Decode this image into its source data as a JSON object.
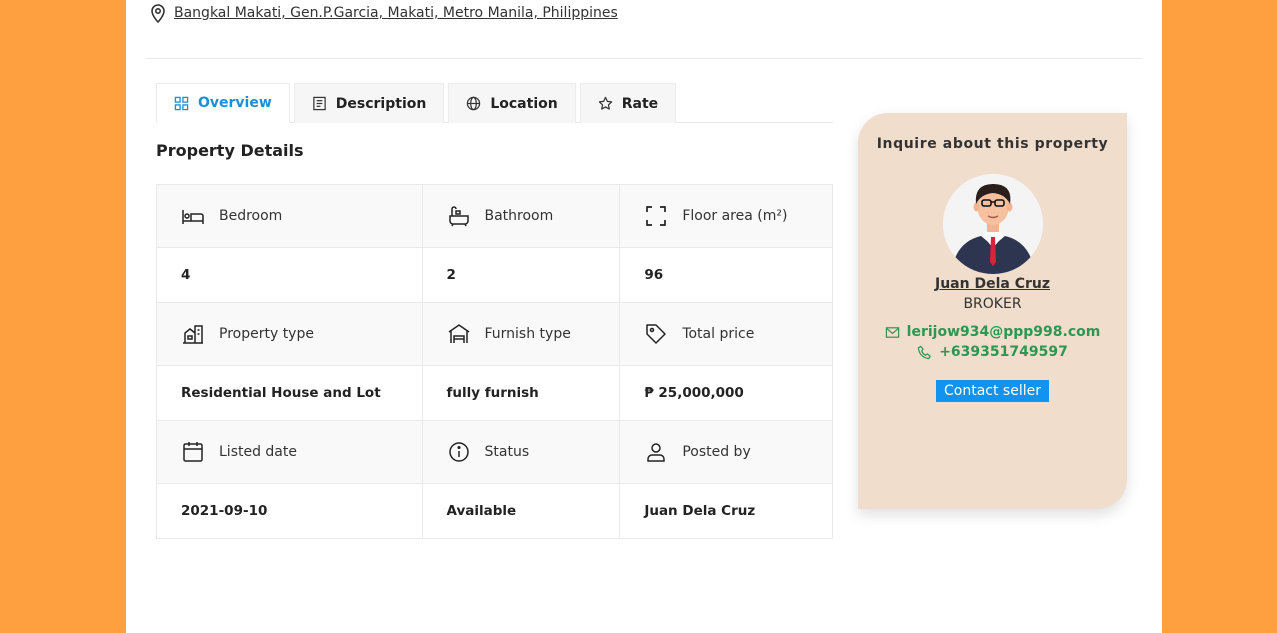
{
  "address": {
    "text": "Bangkal Makati, Gen.P.Garcia, Makati, Metro Manila, Philippines"
  },
  "tabs": [
    {
      "label": "Overview",
      "icon": "grid-icon"
    },
    {
      "label": "Description",
      "icon": "document-icon"
    },
    {
      "label": "Location",
      "icon": "globe-icon"
    },
    {
      "label": "Rate",
      "icon": "star-icon"
    }
  ],
  "active_tab": "Overview",
  "section_title": "Property Details",
  "details": [
    {
      "label": "Bedroom",
      "icon": "bed-icon",
      "value": "4"
    },
    {
      "label": "Bathroom",
      "icon": "bathtub-icon",
      "value": "2"
    },
    {
      "label": "Floor area (m²)",
      "icon": "area-frame-icon",
      "value": "96"
    },
    {
      "label": "Property type",
      "icon": "building-icon",
      "value": "Residential House and Lot"
    },
    {
      "label": "Furnish type",
      "icon": "furnish-icon",
      "value": "fully furnish"
    },
    {
      "label": "Total price",
      "icon": "tag-icon",
      "value": "₱ 25,000,000"
    },
    {
      "label": "Listed date",
      "icon": "calendar-icon",
      "value": "2021-09-10"
    },
    {
      "label": "Status",
      "icon": "info-icon",
      "value": "Available"
    },
    {
      "label": "Posted by",
      "icon": "user-icon",
      "value": "Juan Dela Cruz"
    }
  ],
  "inquiry": {
    "title": "Inquire about this property",
    "agent_name": "Juan Dela Cruz",
    "agent_role": "BROKER",
    "email": "lerijow934@ppp998.com",
    "phone": "+639351749597",
    "button_label": "Contact seller"
  },
  "colors": {
    "background": "#ffa040",
    "accent_blue": "#1a8fdc",
    "contact_green": "#2d9652",
    "card_background": "#f0ddcb"
  }
}
